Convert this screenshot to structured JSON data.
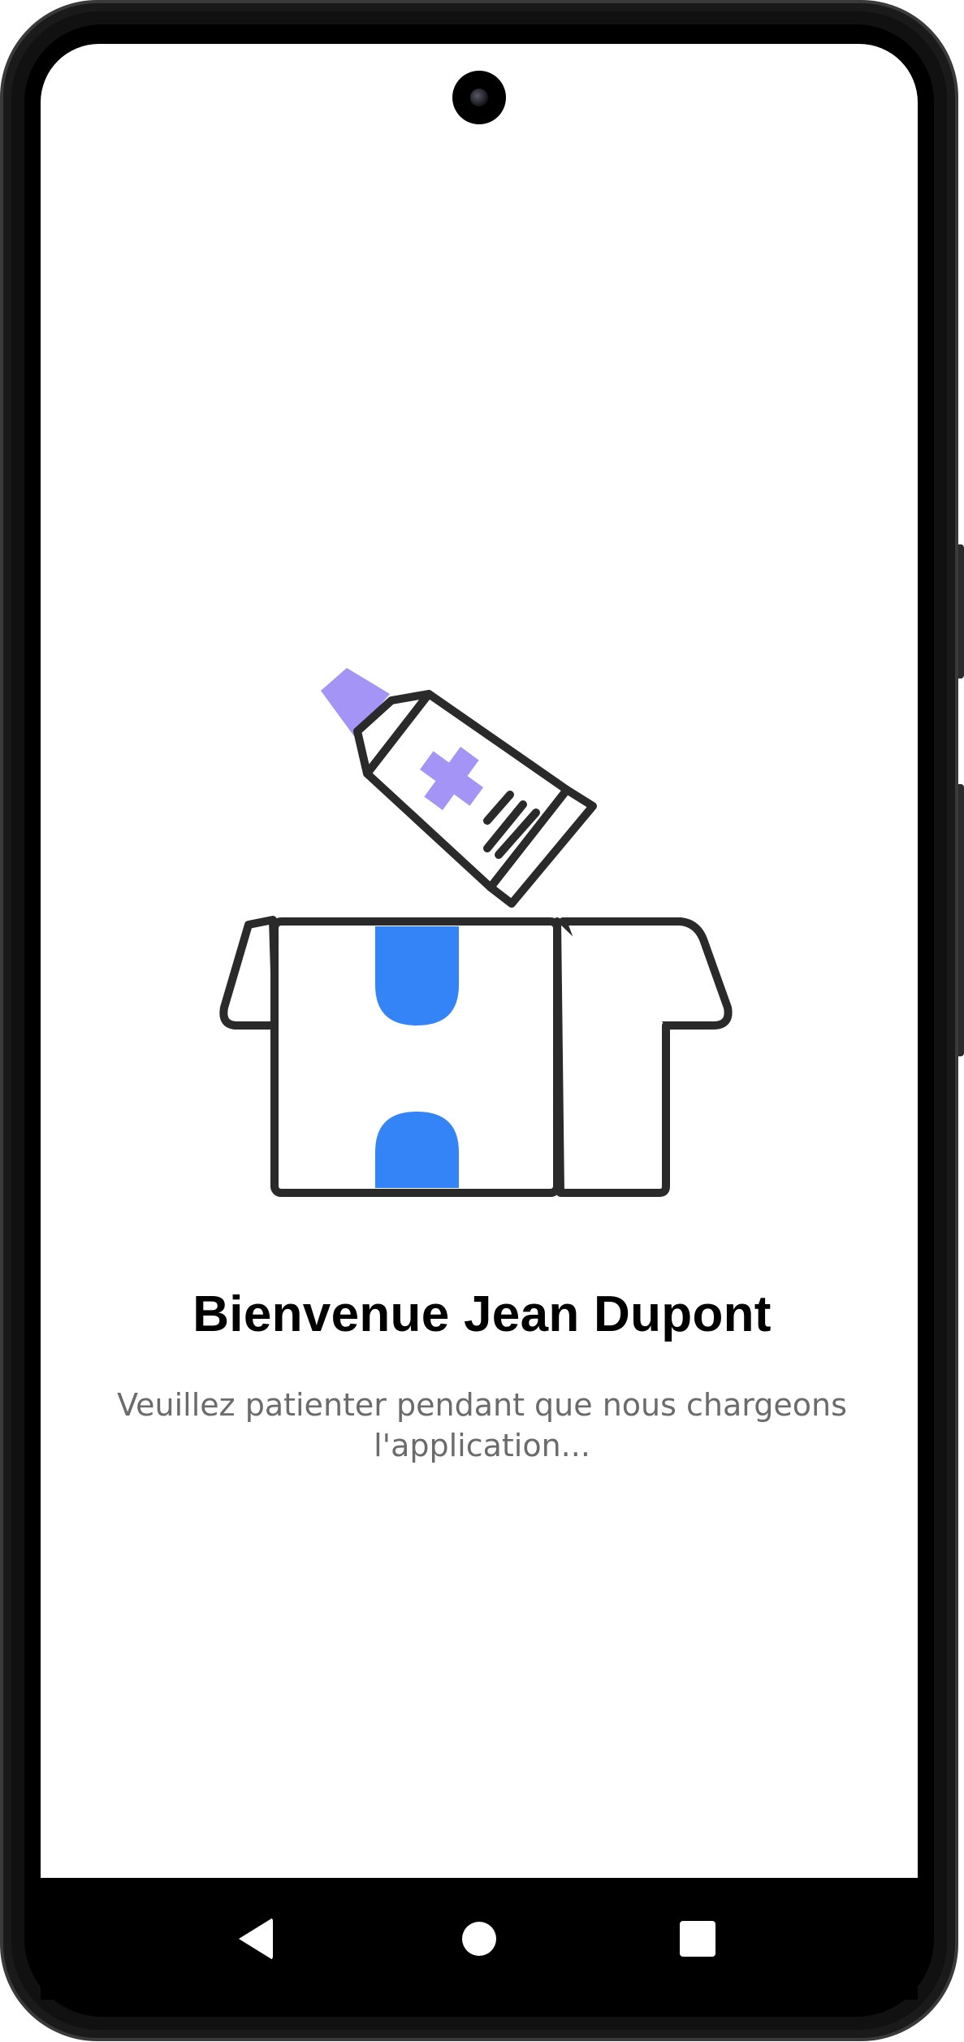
{
  "app": {
    "welcome_title": "Bienvenue Jean Dupont",
    "loading_message": "Veuillez patienter pendant que nous chargeons l'application..."
  },
  "illustration": {
    "icon": "medicine-tube-into-box-icon",
    "colors": {
      "outline": "#2a2a2a",
      "box_tape": "#3584f7",
      "tube_accent": "#a394f5"
    }
  },
  "navigation_bar": {
    "back_icon": "back-triangle-icon",
    "home_icon": "home-circle-icon",
    "recents_icon": "recents-square-icon"
  },
  "colors": {
    "screen_background": "#ffffff",
    "title_text": "#000000",
    "body_text": "#6b6b6b",
    "nav_background": "#000000"
  }
}
